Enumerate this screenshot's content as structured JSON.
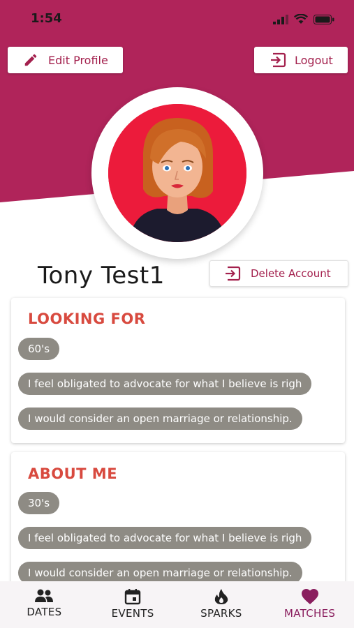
{
  "status_bar": {
    "time": "1:54"
  },
  "header": {
    "edit_profile_label": "Edit Profile",
    "logout_label": "Logout"
  },
  "profile": {
    "name": "Tony Test1",
    "delete_account_label": "Delete Account"
  },
  "looking_for": {
    "title": "LOOKING FOR",
    "chips": [
      "60's",
      "I feel obligated to advocate for what I believe is righ",
      "I would consider an open marriage or relationship."
    ]
  },
  "about_me": {
    "title": "ABOUT ME",
    "chips": [
      "30's",
      "I feel obligated to advocate for what I believe is righ",
      "I would consider an open marriage or relationship."
    ]
  },
  "bottom_nav": {
    "items": [
      {
        "label": "DATES",
        "icon": "people-icon"
      },
      {
        "label": "EVENTS",
        "icon": "calendar-icon"
      },
      {
        "label": "SPARKS",
        "icon": "flame-icon"
      },
      {
        "label": "MATCHES",
        "icon": "heart-icon",
        "active": true
      }
    ]
  },
  "colors": {
    "brand": "#b0245a",
    "accent_text": "#a3204d",
    "section_title": "#d84a3f",
    "chip": "#8e8b84",
    "avatar_bg": "#ec1b3b",
    "active_nav": "#8a1e5e"
  }
}
